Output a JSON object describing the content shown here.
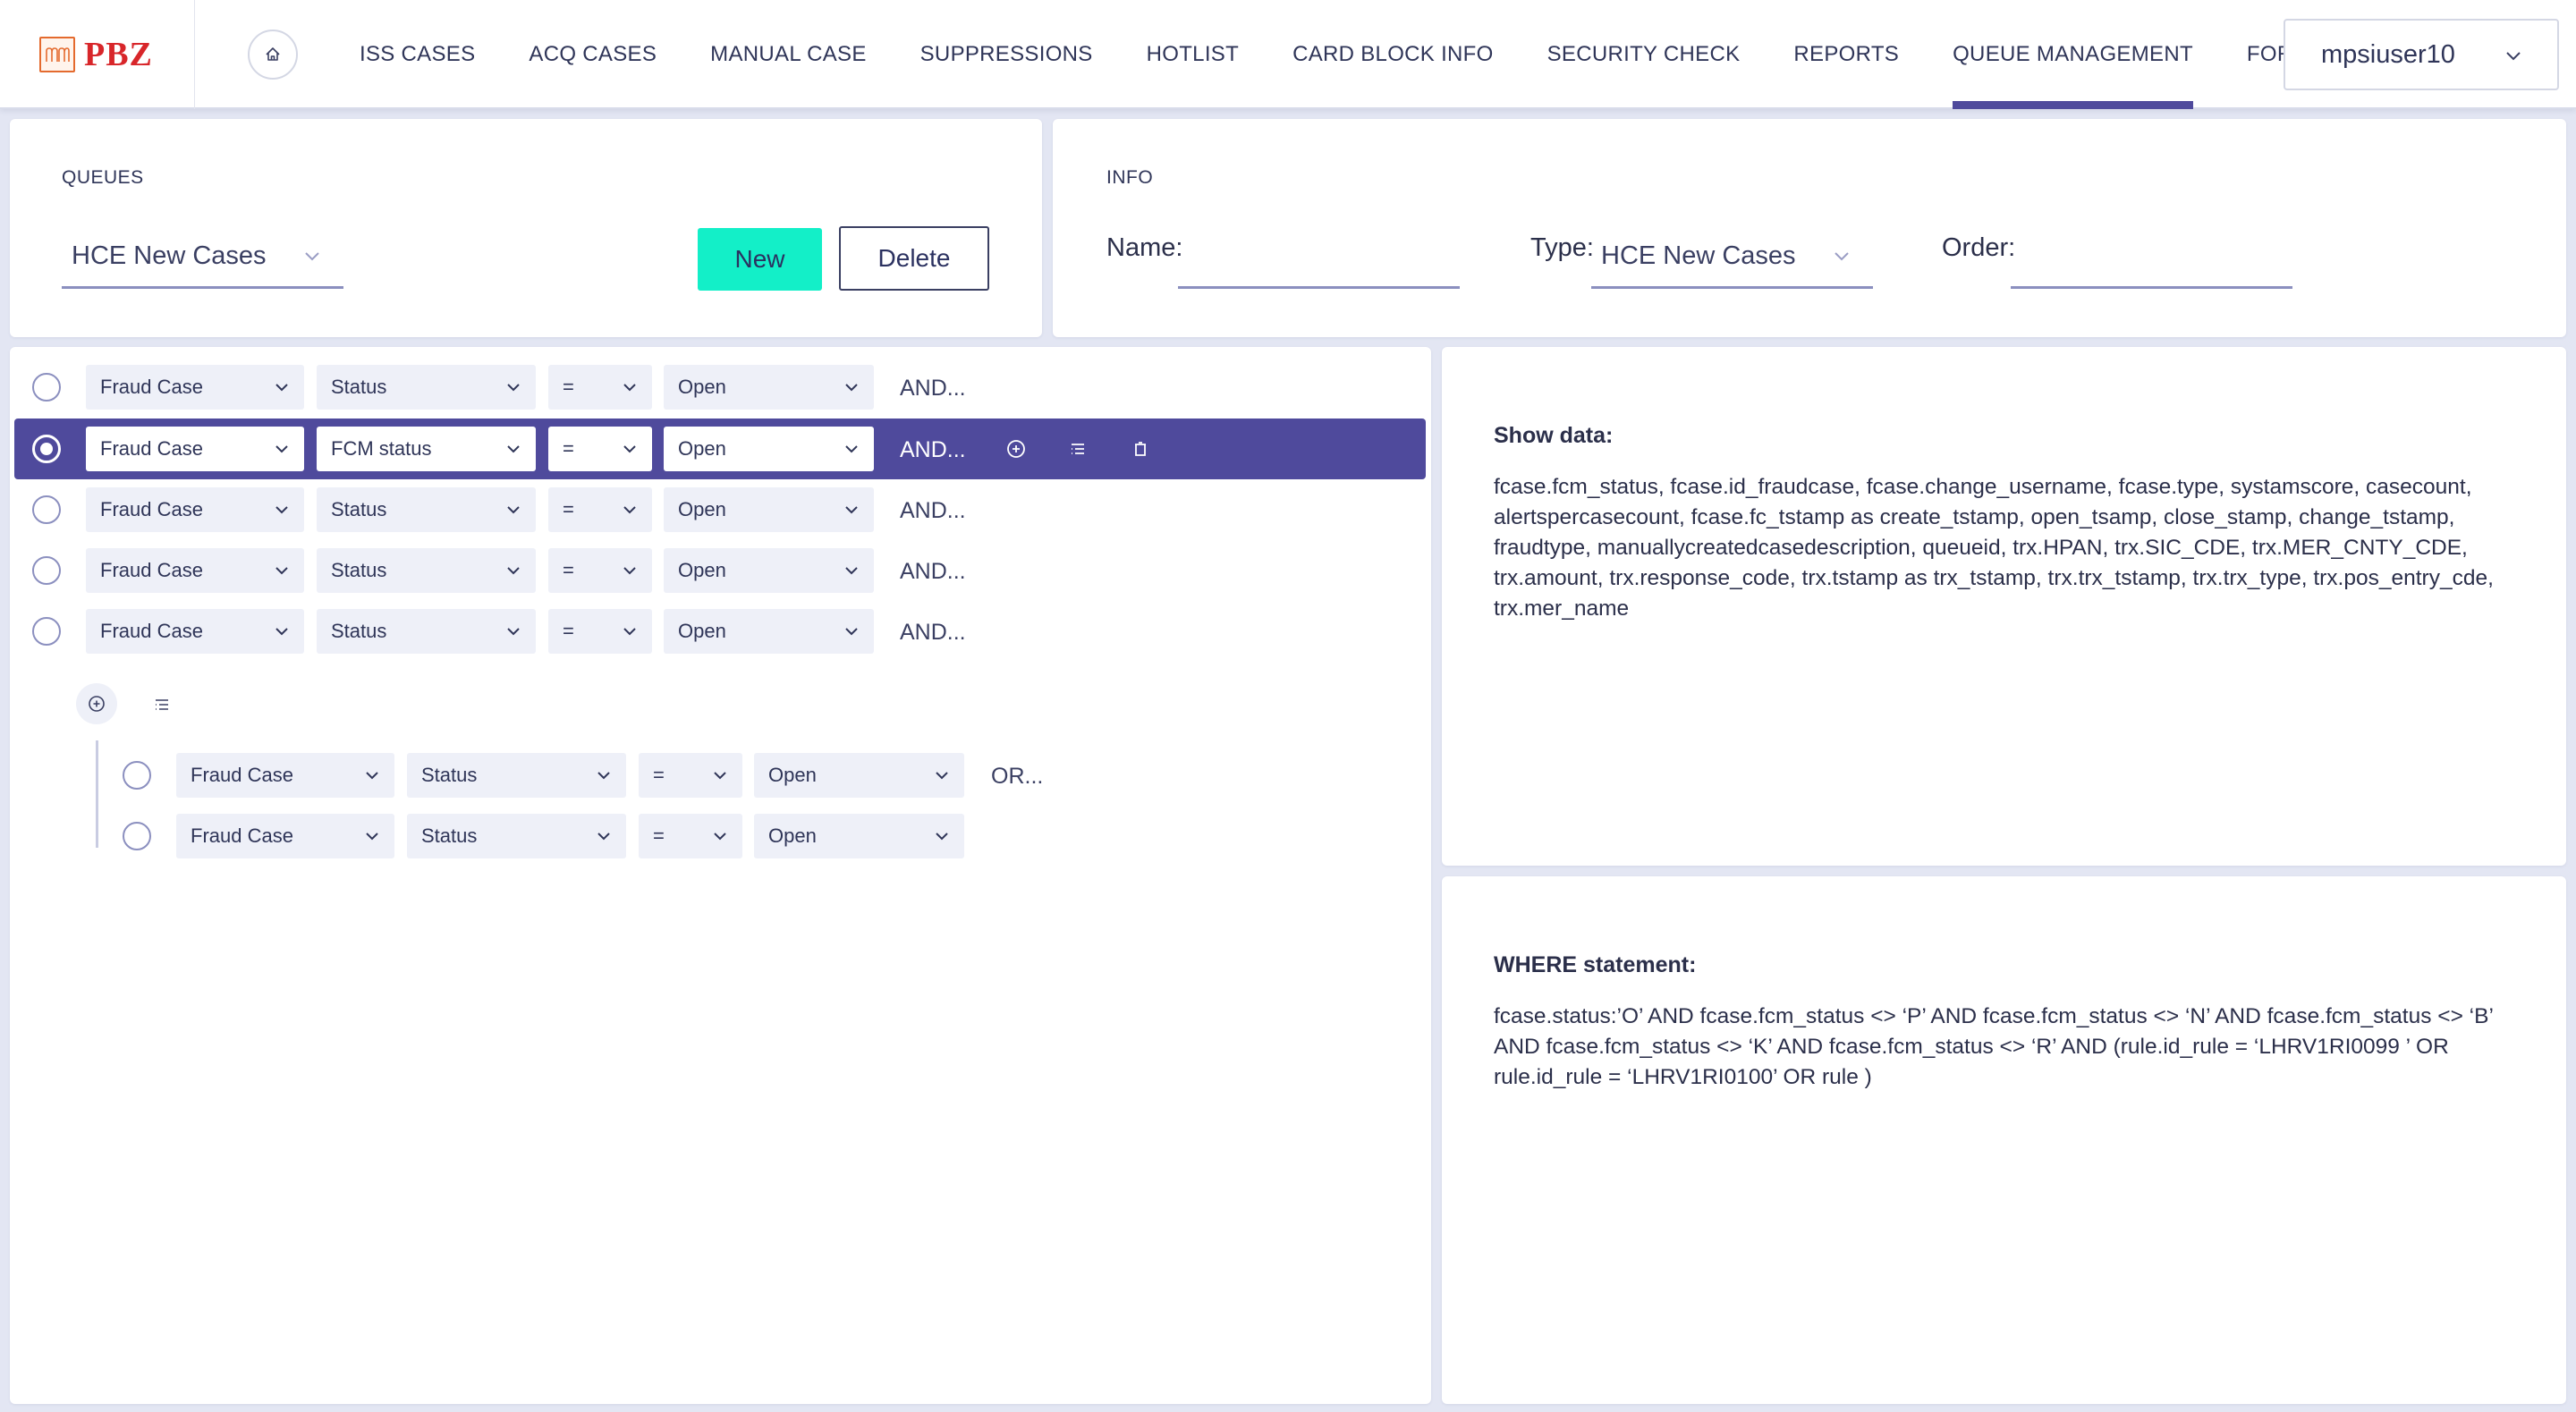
{
  "header": {
    "logo_text": "PBZ",
    "nav": [
      {
        "label": "ISS CASES",
        "active": false
      },
      {
        "label": "ACQ CASES",
        "active": false
      },
      {
        "label": "MANUAL CASE",
        "active": false
      },
      {
        "label": "SUPPRESSIONS",
        "active": false
      },
      {
        "label": "HOTLIST",
        "active": false
      },
      {
        "label": "CARD BLOCK INFO",
        "active": false
      },
      {
        "label": "SECURITY CHECK",
        "active": false
      },
      {
        "label": "REPORTS",
        "active": false
      },
      {
        "label": "QUEUE MANAGEMENT",
        "active": true
      },
      {
        "label": "FORUM",
        "active": false
      }
    ],
    "user": "mpsiuser10"
  },
  "queues": {
    "label": "QUEUES",
    "selected": "HCE New Cases",
    "new_label": "New",
    "delete_label": "Delete"
  },
  "info": {
    "label": "INFO",
    "name_label": "Name:",
    "name_value": "",
    "type_label": "Type:",
    "type_value": "HCE New Cases",
    "order_label": "Order:",
    "order_value": ""
  },
  "rules": [
    {
      "entity": "Fraud Case",
      "field": "Status",
      "op": "=",
      "value": "Open",
      "conj": "AND...",
      "selected": false
    },
    {
      "entity": "Fraud Case",
      "field": "FCM status",
      "op": "=",
      "value": "Open",
      "conj": "AND...",
      "selected": true
    },
    {
      "entity": "Fraud Case",
      "field": "Status",
      "op": "=",
      "value": "Open",
      "conj": "AND...",
      "selected": false
    },
    {
      "entity": "Fraud Case",
      "field": "Status",
      "op": "=",
      "value": "Open",
      "conj": "AND...",
      "selected": false
    },
    {
      "entity": "Fraud Case",
      "field": "Status",
      "op": "=",
      "value": "Open",
      "conj": "AND...",
      "selected": false
    }
  ],
  "group_rules": [
    {
      "entity": "Fraud Case",
      "field": "Status",
      "op": "=",
      "value": "Open",
      "conj": "OR..."
    },
    {
      "entity": "Fraud Case",
      "field": "Status",
      "op": "=",
      "value": "Open",
      "conj": ""
    }
  ],
  "show_data": {
    "title": "Show data:",
    "text": "fcase.fcm_status, fcase.id_fraudcase, fcase.change_username, fcase.type, systamscore, casecount, alertspercasecount, fcase.fc_tstamp as create_tstamp, open_tsamp, close_stamp, change_tstamp, fraudtype, manuallycreatedcasedescription, queueid, trx.HPAN, trx.SIC_CDE, trx.MER_CNTY_CDE, trx.amount, trx.response_code, trx.tstamp as trx_tstamp, trx.trx_tstamp, trx.trx_type, trx.pos_entry_cde, trx.mer_name"
  },
  "where": {
    "title": "WHERE statement:",
    "text": "fcase.status:’O’ AND fcase.fcm_status <> ‘P’ AND fcase.fcm_status <> ‘N’ AND fcase.fcm_status <> ‘B’ AND fcase.fcm_status <> ‘K’ AND fcase.fcm_status <> ‘R’ AND (rule.id_rule = ‘LHRV1RI0099 ’ OR rule.id_rule = ‘LHRV1RI0100’ OR rule )"
  },
  "colors": {
    "accent": "#4f4a9c",
    "new_button": "#13efc8",
    "logo_red": "#d8262a"
  }
}
